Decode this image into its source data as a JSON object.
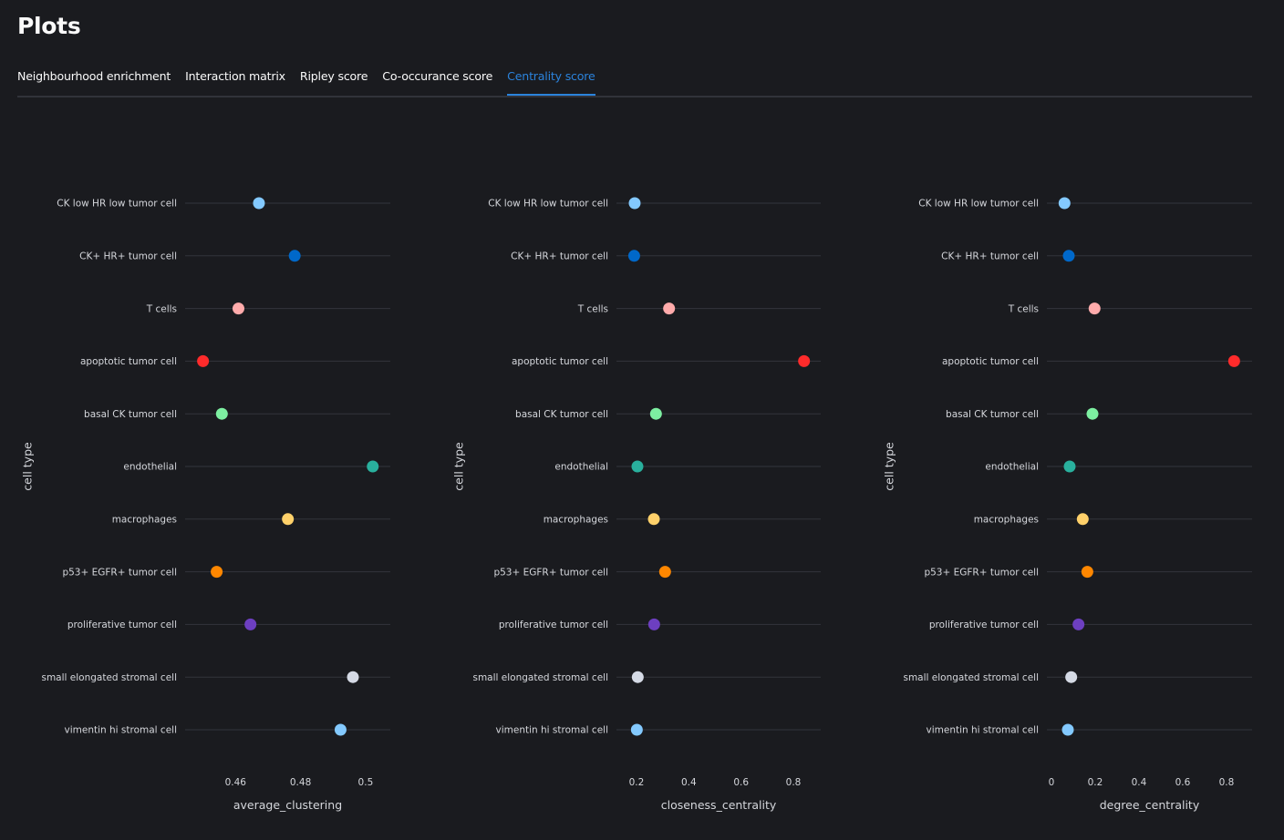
{
  "header": {
    "title": "Plots"
  },
  "tabs": [
    {
      "label": "Neighbourhood enrichment",
      "active": false
    },
    {
      "label": "Interaction matrix",
      "active": false
    },
    {
      "label": "Ripley score",
      "active": false
    },
    {
      "label": "Co-occurance score",
      "active": false
    },
    {
      "label": "Centrality score",
      "active": true
    }
  ],
  "colors": {
    "accent": "#2b83dc",
    "background": "#1a1b1f"
  },
  "chart_data": [
    {
      "type": "scatter",
      "title": "",
      "xlabel": "average_clustering",
      "ylabel": "cell type",
      "xlim": [
        0.4445,
        0.5076
      ],
      "xticks": [
        0.46,
        0.48,
        0.5
      ],
      "xtick_labels": [
        "0.46",
        "0.48",
        "0.5"
      ],
      "grid": true,
      "categories": [
        "CK low HR low tumor cell",
        "CK+ HR+ tumor cell",
        "T cells",
        "apoptotic tumor cell",
        "basal CK tumor cell",
        "endothelial",
        "macrophages",
        "p53+ EGFR+ tumor cell",
        "proliferative tumor cell",
        "small elongated stromal cell",
        "vimentin hi stromal cell"
      ],
      "values": [
        0.4672,
        0.4782,
        0.4609,
        0.45,
        0.4558,
        0.5022,
        0.4761,
        0.4542,
        0.4646,
        0.4961,
        0.4923
      ]
    },
    {
      "type": "scatter",
      "title": "",
      "xlabel": "closeness_centrality",
      "ylabel": "cell type",
      "xlim": [
        0.1233,
        0.9046
      ],
      "xticks": [
        0.2,
        0.4,
        0.6,
        0.8
      ],
      "xtick_labels": [
        "0.2",
        "0.4",
        "0.6",
        "0.8"
      ],
      "grid": true,
      "categories": [
        "CK low HR low tumor cell",
        "CK+ HR+ tumor cell",
        "T cells",
        "apoptotic tumor cell",
        "basal CK tumor cell",
        "endothelial",
        "macrophages",
        "p53+ EGFR+ tumor cell",
        "proliferative tumor cell",
        "small elongated stromal cell",
        "vimentin hi stromal cell"
      ],
      "values": [
        0.193,
        0.191,
        0.3245,
        0.8407,
        0.2744,
        0.2035,
        0.2663,
        0.3093,
        0.2674,
        0.2047,
        0.2012
      ]
    },
    {
      "type": "scatter",
      "title": "",
      "xlabel": "degree_centrality",
      "ylabel": "cell type",
      "xlim": [
        -0.0208,
        0.9167
      ],
      "xticks": [
        0,
        0.2,
        0.4,
        0.6,
        0.8
      ],
      "xtick_labels": [
        "0",
        "0.2",
        "0.4",
        "0.6",
        "0.8"
      ],
      "grid": true,
      "categories": [
        "CK low HR low tumor cell",
        "CK+ HR+ tumor cell",
        "T cells",
        "apoptotic tumor cell",
        "basal CK tumor cell",
        "endothelial",
        "macrophages",
        "p53+ EGFR+ tumor cell",
        "proliferative tumor cell",
        "small elongated stromal cell",
        "vimentin hi stromal cell"
      ],
      "values": [
        0.0597,
        0.0792,
        0.197,
        0.8347,
        0.1875,
        0.0833,
        0.143,
        0.164,
        0.1236,
        0.0903,
        0.075
      ]
    }
  ],
  "category_colors": [
    "#83c9ff",
    "#0068c9",
    "#ffabab",
    "#ff2b2b",
    "#7defa1",
    "#29b09d",
    "#ffd16a",
    "#ff8700",
    "#6d3fc0",
    "#d5dae5",
    "#83c9ff"
  ]
}
